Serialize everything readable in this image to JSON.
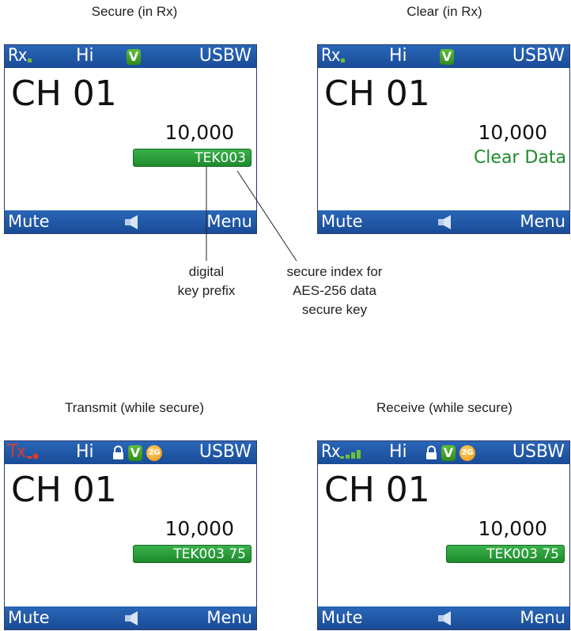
{
  "panels": [
    {
      "caption": "Secure (in Rx)",
      "mode": "Rx.",
      "power": "Hi",
      "badge_v": "V",
      "bandwidth": "USBW",
      "channel": "CH 01",
      "frequency": "10,000",
      "key_label": "TEK003",
      "left_softkey": "Mute",
      "right_softkey": "Menu"
    },
    {
      "caption": "Clear (in Rx)",
      "mode": "Rx.",
      "power": "Hi",
      "badge_v": "V",
      "bandwidth": "USBW",
      "channel": "CH 01",
      "frequency": "10,000",
      "status_text": "Clear Data",
      "left_softkey": "Mute",
      "right_softkey": "Menu"
    },
    {
      "caption": "Transmit (while secure)",
      "mode": "Tx",
      "power": "Hi",
      "badge_v": "V",
      "badge_2g": "2G",
      "bandwidth": "USBW",
      "channel": "CH 01",
      "frequency": "10,000",
      "key_label": "TEK003 75",
      "left_softkey": "Mute",
      "right_softkey": "Menu"
    },
    {
      "caption": "Receive (while secure)",
      "mode": "Rx",
      "power": "Hi",
      "badge_v": "V",
      "badge_2g": "2G",
      "bandwidth": "USBW",
      "channel": "CH 01",
      "frequency": "10,000",
      "key_label": "TEK003 75",
      "left_softkey": "Mute",
      "right_softkey": "Menu"
    }
  ],
  "annotations": {
    "digital_prefix": "digital\nkey prefix",
    "secure_index": "secure index for\nAES-256 data\nsecure key"
  },
  "colors": {
    "bar_blue": "#1f57a6",
    "key_green": "#2a9d3a",
    "tx_red": "#e53929",
    "signal_green": "#6fbf3a"
  }
}
